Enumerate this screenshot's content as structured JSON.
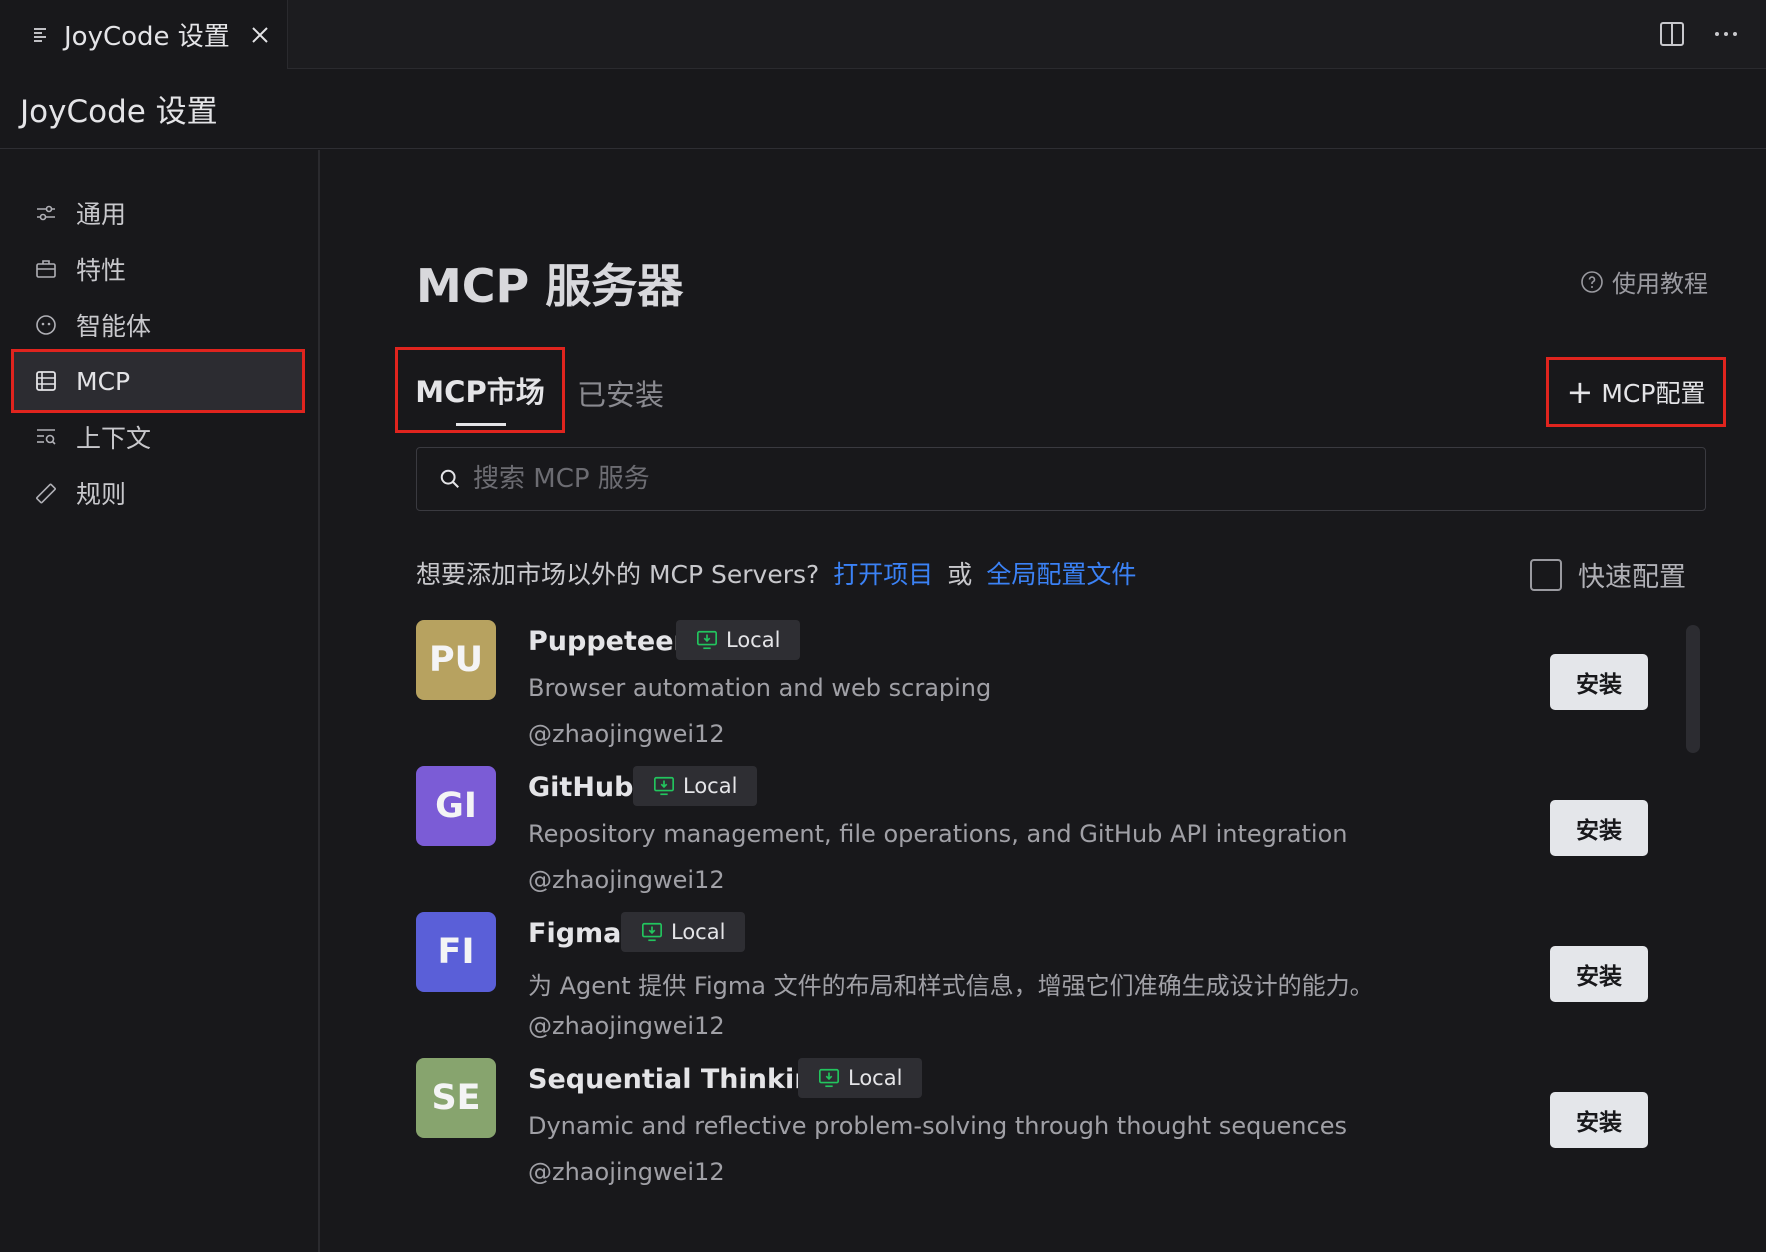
{
  "tab": {
    "title": "JoyCode 设置"
  },
  "header": {
    "title": "JoyCode 设置"
  },
  "sidebar": {
    "items": [
      {
        "label": "通用",
        "icon": "sliders-icon"
      },
      {
        "label": "特性",
        "icon": "briefcase-icon"
      },
      {
        "label": "智能体",
        "icon": "agent-icon"
      },
      {
        "label": "MCP",
        "icon": "server-icon"
      },
      {
        "label": "上下文",
        "icon": "context-search-icon"
      },
      {
        "label": "规则",
        "icon": "ruler-icon"
      }
    ],
    "active_index": 3
  },
  "main": {
    "title": "MCP 服务器",
    "help_link": "使用教程",
    "tabs": [
      {
        "label": "MCP市场",
        "active": true
      },
      {
        "label": "已安装",
        "active": false
      }
    ],
    "add_config_label": "MCP配置",
    "search_placeholder": "搜索 MCP 服务",
    "info_text": "想要添加市场以外的 MCP Servers?",
    "link_open_project": "打开项目",
    "or_text": "或",
    "link_global_config": "全局配置文件",
    "quick_config_label": "快速配置"
  },
  "servers": [
    {
      "initials": "PU",
      "name": "Puppeteer",
      "badge": "Local",
      "desc": "Browser automation and web scraping",
      "author": "@zhaojingwei12",
      "color": "#b7a260",
      "install_label": "安装"
    },
    {
      "initials": "GI",
      "name": "GitHub",
      "badge": "Local",
      "desc": "Repository management, file operations, and GitHub API integration",
      "author": "@zhaojingwei12",
      "color": "#7b5cd6",
      "install_label": "安装"
    },
    {
      "initials": "FI",
      "name": "Figma",
      "badge": "Local",
      "desc": "为 Agent 提供 Figma 文件的布局和样式信息，增强它们准确生成设计的能力。",
      "author": "@zhaojingwei12",
      "color": "#5a5fd8",
      "install_label": "安装"
    },
    {
      "initials": "SE",
      "name": "Sequential Thinking",
      "badge": "Local",
      "desc": "Dynamic and reflective problem-solving through thought sequences",
      "author": "@zhaojingwei12",
      "color": "#87a46e",
      "install_label": "安装"
    }
  ],
  "colors": {
    "accent_link": "#3b82f6",
    "highlight_outline": "#e0241e",
    "badge_icon": "#22c55e"
  }
}
